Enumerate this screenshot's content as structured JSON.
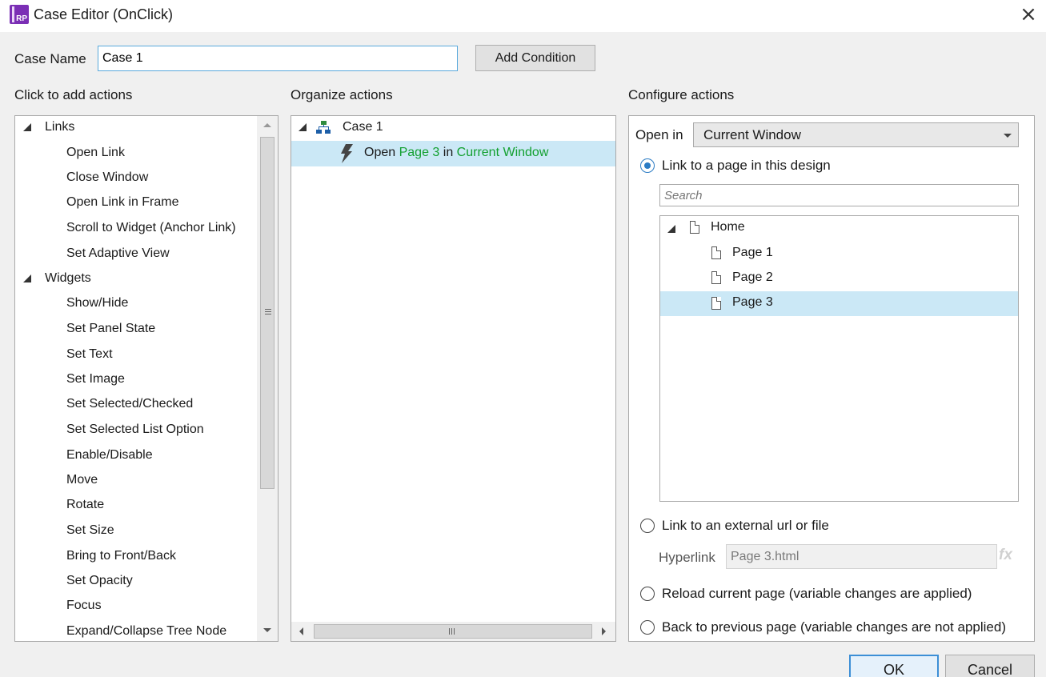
{
  "window": {
    "title": "Case Editor (OnClick)",
    "app_icon_text": "RP"
  },
  "case_name": {
    "label": "Case Name",
    "value": "Case 1"
  },
  "add_condition_label": "Add Condition",
  "left_panel": {
    "header": "Click to add actions",
    "groups": [
      {
        "label": "Links",
        "items": [
          {
            "label": "Open Link",
            "expandable": true
          },
          {
            "label": "Close Window",
            "expandable": false
          },
          {
            "label": "Open Link in Frame",
            "expandable": true
          },
          {
            "label": "Scroll to Widget (Anchor Link)",
            "expandable": false
          },
          {
            "label": "Set Adaptive View",
            "expandable": false
          }
        ]
      },
      {
        "label": "Widgets",
        "items": [
          {
            "label": "Show/Hide",
            "expandable": true
          },
          {
            "label": "Set Panel State",
            "expandable": false
          },
          {
            "label": "Set Text",
            "expandable": false
          },
          {
            "label": "Set Image",
            "expandable": false
          },
          {
            "label": "Set Selected/Checked",
            "expandable": true
          },
          {
            "label": "Set Selected List Option",
            "expandable": false
          },
          {
            "label": "Enable/Disable",
            "expandable": true
          },
          {
            "label": "Move",
            "expandable": false
          },
          {
            "label": "Rotate",
            "expandable": false
          },
          {
            "label": "Set Size",
            "expandable": false
          },
          {
            "label": "Bring to Front/Back",
            "expandable": true
          },
          {
            "label": "Set Opacity",
            "expandable": false
          },
          {
            "label": "Focus",
            "expandable": false
          },
          {
            "label": "Expand/Collapse Tree Node",
            "expandable": true
          }
        ]
      }
    ]
  },
  "middle_panel": {
    "header": "Organize actions",
    "case_label": "Case 1",
    "action": {
      "verb": "Open",
      "target": "Page 3",
      "preposition": "in",
      "location": "Current Window"
    }
  },
  "right_panel": {
    "header": "Configure actions",
    "open_in_label": "Open in",
    "open_in_value": "Current Window",
    "options": {
      "link_page": "Link to a page in this design",
      "link_external": "Link to an external url or file",
      "reload": "Reload current page (variable changes are applied)",
      "back": "Back to previous page (variable changes are not applied)"
    },
    "selected_option": "link_page",
    "search_placeholder": "Search",
    "pages": {
      "root": "Home",
      "children": [
        "Page 1",
        "Page 2",
        "Page 3"
      ],
      "selected": "Page 3"
    },
    "hyperlink_label": "Hyperlink",
    "hyperlink_value": "Page 3.html",
    "fx_label": "fx"
  },
  "footer": {
    "ok_label": "OK",
    "cancel_label": "Cancel"
  },
  "colors": {
    "accent_blue": "#2b7bc4",
    "selection_bg": "#cbe8f6",
    "highlight_green": "#13a030",
    "app_icon_purple": "#7b2fb5"
  }
}
